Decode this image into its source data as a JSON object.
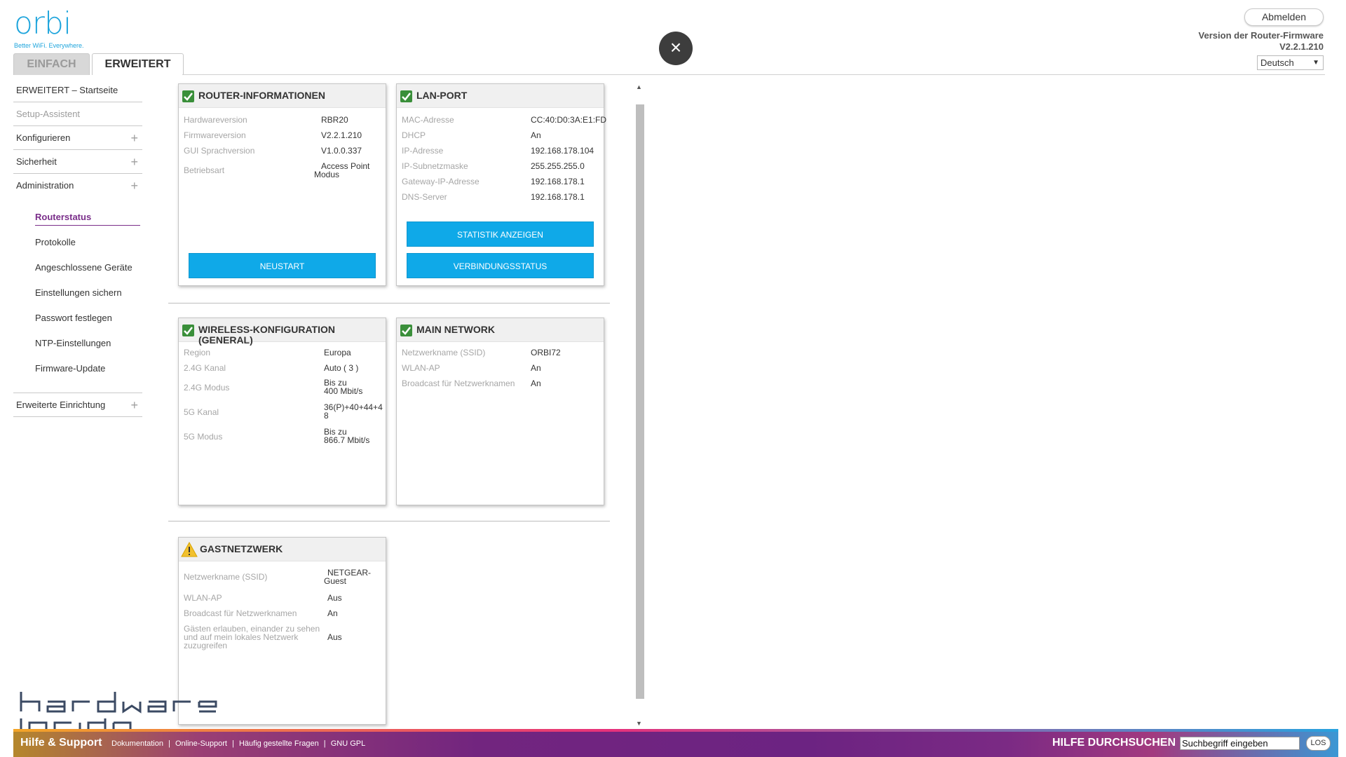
{
  "brand": {
    "logo_text": "orbi",
    "tagline": "Better WiFi. Everywhere."
  },
  "tabs": [
    {
      "label": "EINFACH",
      "active": false
    },
    {
      "label": "ERWEITERT",
      "active": true
    }
  ],
  "header": {
    "logout_label": "Abmelden",
    "firmware_label": "Version der Router-Firmware",
    "firmware_version": "V2.2.1.210",
    "language": "Deutsch"
  },
  "close_label": "×",
  "sidebar": {
    "items": [
      {
        "label": "ERWEITERT – Startseite",
        "expandable": false
      },
      {
        "label": "Setup-Assistent",
        "expandable": false,
        "disabled": true
      },
      {
        "label": "Konfigurieren",
        "expandable": true
      },
      {
        "label": "Sicherheit",
        "expandable": true
      },
      {
        "label": "Administration",
        "expandable": true
      }
    ],
    "administration_sub": [
      {
        "label": "Routerstatus",
        "active": true
      },
      {
        "label": "Protokolle"
      },
      {
        "label": "Angeschlossene Geräte"
      },
      {
        "label": "Einstellungen sichern"
      },
      {
        "label": "Passwort festlegen"
      },
      {
        "label": "NTP-Einstellungen"
      },
      {
        "label": "Firmware-Update"
      }
    ],
    "advanced_setup": "Erweiterte Einrichtung",
    "plus": "+"
  },
  "router_info": {
    "title": "ROUTER-INFORMATIONEN",
    "rows": [
      {
        "k": "Hardwareversion",
        "v": "RBR20"
      },
      {
        "k": "Firmwareversion",
        "v": "V2.2.1.210"
      },
      {
        "k": "GUI Sprachversion",
        "v": "V1.0.0.337"
      },
      {
        "k": "Betriebsart",
        "v1": "Access Point",
        "v2": "Modus"
      }
    ],
    "restart_button": "NEUSTART"
  },
  "lan_port": {
    "title": "LAN-PORT",
    "rows": [
      {
        "k": "MAC-Adresse",
        "v": "CC:40:D0:3A:E1:FD"
      },
      {
        "k": "DHCP",
        "v": "An"
      },
      {
        "k": "IP-Adresse",
        "v": "192.168.178.104"
      },
      {
        "k": "IP-Subnetzmaske",
        "v": "255.255.255.0"
      },
      {
        "k": "Gateway-IP-Adresse",
        "v": "192.168.178.1"
      },
      {
        "k": "DNS-Server",
        "v": "192.168.178.1"
      }
    ],
    "stats_button": "STATISTIK ANZEIGEN",
    "connection_button": "VERBINDUNGSSTATUS"
  },
  "wireless": {
    "title1": "WIRELESS-KONFIGURATION",
    "title2": "(GENERAL)",
    "rows": [
      {
        "k": "Region",
        "v": "Europa"
      },
      {
        "k": "2.4G Kanal",
        "v": "Auto ( 3 )"
      },
      {
        "k": "2.4G Modus",
        "v1": "Bis zu",
        "v2": "400 Mbit/s"
      },
      {
        "k": "5G Kanal",
        "v1": "36(P)+40+44+4",
        "v2": "8"
      },
      {
        "k": "5G Modus",
        "v1": "Bis zu",
        "v2": "866.7 Mbit/s"
      }
    ]
  },
  "main_network": {
    "title": "MAIN NETWORK",
    "rows": [
      {
        "k": "Netzwerkname (SSID)",
        "v": "ORBI72"
      },
      {
        "k": "WLAN-AP",
        "v": "An"
      },
      {
        "k": "Broadcast für Netzwerknamen",
        "v": "An"
      }
    ]
  },
  "guest": {
    "title": "GASTNETZWERK",
    "rows": [
      {
        "k": "Netzwerkname (SSID)",
        "v1": "NETGEAR-",
        "v2": "Guest"
      },
      {
        "k": "WLAN-AP",
        "v": "Aus"
      },
      {
        "k": "Broadcast für Netzwerknamen",
        "v": "An"
      },
      {
        "k1": "Gästen erlauben, einander zu sehen",
        "k2": "und auf mein lokales Netzwerk",
        "k3": "zuzugreifen",
        "v": "Aus"
      }
    ]
  },
  "footer": {
    "help": "Hilfe & Support",
    "links": [
      "Dokumentation",
      "Online-Support",
      "Häufig gestellte Fragen",
      "GNU GPL"
    ],
    "separator": "|",
    "search_label": "HILFE DURCHSUCHEN",
    "search_value": "Suchbegriff eingeben",
    "go_label": "LOS"
  },
  "colors": {
    "accent_blue": "#0fa9e8",
    "brand_purple": "#7a2e8a",
    "check_green": "#3a8f3a"
  }
}
